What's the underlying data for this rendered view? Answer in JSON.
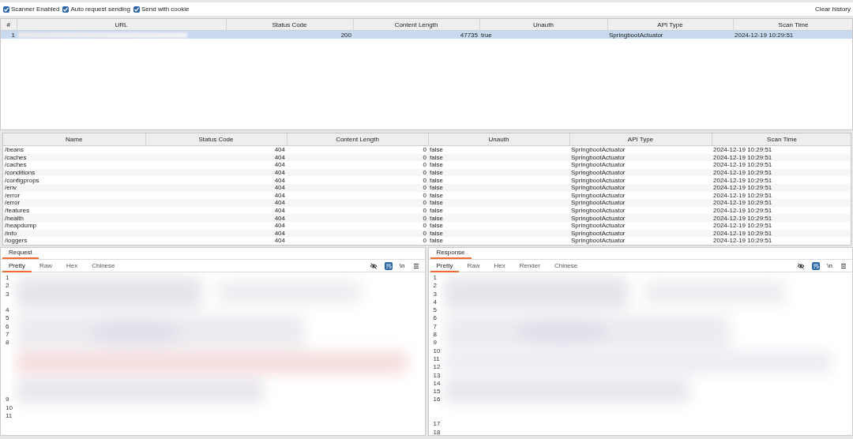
{
  "toolbar": {
    "options": [
      {
        "label": "Scanner Enabled",
        "checked": true
      },
      {
        "label": "Auto request sending",
        "checked": true
      },
      {
        "label": "Send with cookie",
        "checked": true
      }
    ],
    "clear_button": "Clear history"
  },
  "scan_table": {
    "columns": [
      {
        "label": "#",
        "kind": "number"
      },
      {
        "label": "URL",
        "kind": "redacted"
      },
      {
        "label": "Status Code",
        "kind": "number"
      },
      {
        "label": "Content Length",
        "kind": "number"
      },
      {
        "label": "Unauth",
        "kind": "text"
      },
      {
        "label": "API Type",
        "kind": "text"
      },
      {
        "label": "Scan Time",
        "kind": "text"
      }
    ],
    "rows": [
      {
        "cells": [
          "1",
          "",
          "200",
          "47735",
          "true",
          "SpringbootActuator",
          "2024-12-19 10:29:51"
        ],
        "selected": true
      }
    ]
  },
  "endpoint_table": {
    "columns": [
      {
        "label": "Name",
        "kind": "text"
      },
      {
        "label": "Status Code",
        "kind": "number"
      },
      {
        "label": "Content Length",
        "kind": "number"
      },
      {
        "label": "Unauth",
        "kind": "text"
      },
      {
        "label": "API Type",
        "kind": "text"
      },
      {
        "label": "Scan Time",
        "kind": "text"
      }
    ],
    "rows": [
      {
        "cells": [
          "/beans",
          "404",
          "0",
          "false",
          "SpringbootActuator",
          "2024-12-19 10:29:51"
        ],
        "selected": false
      },
      {
        "cells": [
          "/caches",
          "404",
          "0",
          "false",
          "SpringbootActuator",
          "2024-12-19 10:29:51"
        ],
        "selected": false
      },
      {
        "cells": [
          "/caches",
          "404",
          "0",
          "false",
          "SpringbootActuator",
          "2024-12-19 10:29:51"
        ],
        "selected": false
      },
      {
        "cells": [
          "/conditions",
          "404",
          "0",
          "false",
          "SpringbootActuator",
          "2024-12-19 10:29:51"
        ],
        "selected": false
      },
      {
        "cells": [
          "/configprops",
          "404",
          "0",
          "false",
          "SpringbootActuator",
          "2024-12-19 10:29:51"
        ],
        "selected": false
      },
      {
        "cells": [
          "/env",
          "404",
          "0",
          "false",
          "SpringbootActuator",
          "2024-12-19 10:29:51"
        ],
        "selected": false
      },
      {
        "cells": [
          "/error",
          "404",
          "0",
          "false",
          "SpringbootActuator",
          "2024-12-19 10:29:51"
        ],
        "selected": false
      },
      {
        "cells": [
          "/error",
          "404",
          "0",
          "false",
          "SpringbootActuator",
          "2024-12-19 10:29:51"
        ],
        "selected": false
      },
      {
        "cells": [
          "/features",
          "404",
          "0",
          "false",
          "SpringbootActuator",
          "2024-12-19 10:29:51"
        ],
        "selected": false
      },
      {
        "cells": [
          "/health",
          "404",
          "0",
          "false",
          "SpringbootActuator",
          "2024-12-19 10:29:51"
        ],
        "selected": false
      },
      {
        "cells": [
          "/heapdump",
          "404",
          "0",
          "false",
          "SpringbootActuator",
          "2024-12-19 10:29:51"
        ],
        "selected": false
      },
      {
        "cells": [
          "/info",
          "404",
          "0",
          "false",
          "SpringbootActuator",
          "2024-12-19 10:29:51"
        ],
        "selected": false
      },
      {
        "cells": [
          "/loggers",
          "404",
          "0",
          "false",
          "SpringbootActuator",
          "2024-12-19 10:29:51"
        ],
        "selected": false
      }
    ]
  },
  "request": {
    "title": "Request",
    "tabs": [
      {
        "label": "Pretty",
        "selected": true
      },
      {
        "label": "Raw",
        "selected": false
      },
      {
        "label": "Hex",
        "selected": false
      },
      {
        "label": "Chinese",
        "selected": false
      }
    ],
    "tools": [
      {
        "kind": "hide",
        "on": false
      },
      {
        "kind": "wrap",
        "on": true
      },
      {
        "kind": "newline",
        "label": "\\n",
        "on": false
      },
      {
        "kind": "menu",
        "on": false
      }
    ],
    "lines": [
      {
        "number": "1",
        "kind": "single"
      },
      {
        "number": "2",
        "kind": "single"
      },
      {
        "number": "3",
        "kind": "double"
      },
      {
        "number": "4",
        "kind": "single"
      },
      {
        "number": "5",
        "kind": "single"
      },
      {
        "number": "6",
        "kind": "single"
      },
      {
        "number": "7",
        "kind": "single"
      },
      {
        "number": "8",
        "kind": "long"
      },
      {
        "number": "9",
        "kind": "single"
      },
      {
        "number": "10",
        "kind": "single"
      },
      {
        "number": "11",
        "kind": "single"
      }
    ]
  },
  "response": {
    "title": "Response",
    "tabs": [
      {
        "label": "Pretty",
        "selected": true
      },
      {
        "label": "Raw",
        "selected": false
      },
      {
        "label": "Hex",
        "selected": false
      },
      {
        "label": "Render",
        "selected": false
      },
      {
        "label": "Chinese",
        "selected": false
      }
    ],
    "tools": [
      {
        "kind": "hide",
        "on": false
      },
      {
        "kind": "wrap",
        "on": true
      },
      {
        "kind": "newline",
        "label": "\\n",
        "on": false
      },
      {
        "kind": "menu",
        "on": false
      }
    ],
    "lines": [
      {
        "number": "1",
        "kind": "single"
      },
      {
        "number": "2",
        "kind": "single"
      },
      {
        "number": "3",
        "kind": "single"
      },
      {
        "number": "4",
        "kind": "single"
      },
      {
        "number": "5",
        "kind": "single"
      },
      {
        "number": "6",
        "kind": "single"
      },
      {
        "number": "7",
        "kind": "single"
      },
      {
        "number": "8",
        "kind": "single"
      },
      {
        "number": "9",
        "kind": "single"
      },
      {
        "number": "10",
        "kind": "single"
      },
      {
        "number": "11",
        "kind": "single"
      },
      {
        "number": "12",
        "kind": "single"
      },
      {
        "number": "13",
        "kind": "single"
      },
      {
        "number": "14",
        "kind": "single"
      },
      {
        "number": "15",
        "kind": "single"
      },
      {
        "number": "16",
        "kind": "triple"
      },
      {
        "number": "17",
        "kind": "single"
      },
      {
        "number": "18",
        "kind": "single"
      }
    ]
  }
}
